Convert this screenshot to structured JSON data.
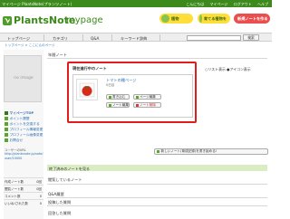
{
  "topbar": {
    "title": "マイページ PlantsNote(プランツノート)",
    "links": [
      "こんにちは",
      "マイページ",
      "ログアウト",
      "ヘルプ"
    ]
  },
  "header": {
    "logo_text": "PlantsNote",
    "logo_sub": "mypage",
    "buttons": [
      "植物",
      "育てる植物を",
      "新規ノートを作る"
    ]
  },
  "nav": {
    "items": [
      "トップページ",
      "カテゴリ",
      "Q&A",
      "キーワード辞典"
    ],
    "search_placeholder": "",
    "search_button": "検索"
  },
  "breadcrumb": "トップページ > ここにんのページ",
  "sidebar": {
    "avatar_text": "no image",
    "links": [
      "マイページTOP",
      "ポイント履歴",
      "ポイントを交換する",
      "プロフィール情報変更",
      "プロフィール画像変更",
      "お問合せ"
    ],
    "url_label": "ユーザーのURL",
    "url_value": "http://plantsnote.jp/note/user/10000",
    "stats": [
      {
        "label": "作成ノート数",
        "value": "0回"
      },
      {
        "label": "閲覧ノート数",
        "value": "0回"
      },
      {
        "label": "コメント数",
        "value": "0"
      },
      {
        "label": "いいね!された数",
        "value": "0"
      }
    ]
  },
  "main": {
    "section_title": "年間ノート",
    "active_title": "現在進行中のノート",
    "view_list": "○リスト表示",
    "view_icon": "●アイコン表示",
    "note_link": "トマトの種ページ",
    "note_count": "0日目",
    "buttons": [
      "書き込む",
      "ページ編集",
      "ノート編集",
      "ノート削除"
    ],
    "create_button": "新しいノート(育成記録)を書き始める!",
    "finished_label": "終了済みのノートを見る",
    "following_label": "閲覧しているノート",
    "qa_label": "Q&A履歴",
    "question_label": "投稿した質問",
    "answer_label": "回答した質問"
  }
}
